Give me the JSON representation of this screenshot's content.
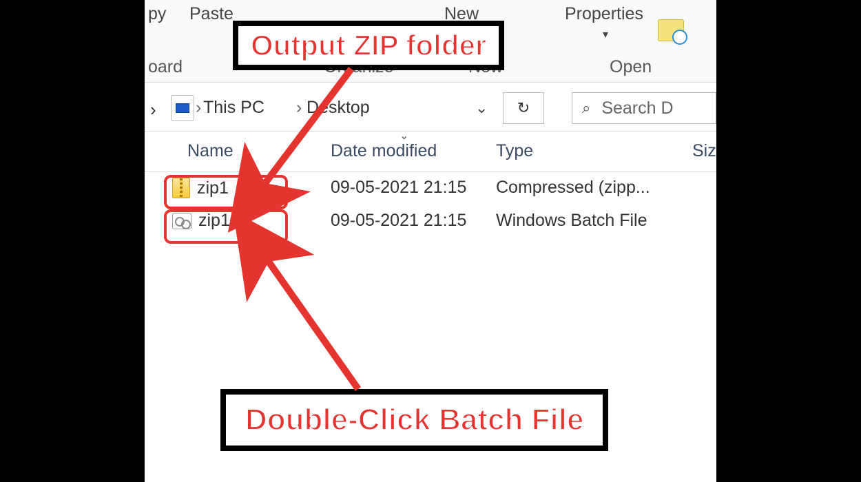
{
  "ribbon": {
    "copy": "py",
    "paste": "Paste",
    "new": "New",
    "properties": "Properties",
    "group_clipboard": "oard",
    "group_organize": "Organize",
    "group_new": "New",
    "group_open": "Open"
  },
  "breadcrumb": {
    "this_pc": "This PC",
    "desktop": "Desktop"
  },
  "search": {
    "placeholder": "Search D"
  },
  "columns": {
    "name": "Name",
    "date": "Date modified",
    "type": "Type",
    "size": "Siz"
  },
  "files": [
    {
      "name": "zip1",
      "date": "09-05-2021 21:15",
      "type": "Compressed (zipp...",
      "icon": "zip"
    },
    {
      "name": "zip1",
      "date": "09-05-2021 21:15",
      "type": "Windows Batch File",
      "icon": "bat"
    }
  ],
  "annotations": {
    "top": "Output ZIP folder",
    "bottom": "Double-Click Batch File"
  }
}
